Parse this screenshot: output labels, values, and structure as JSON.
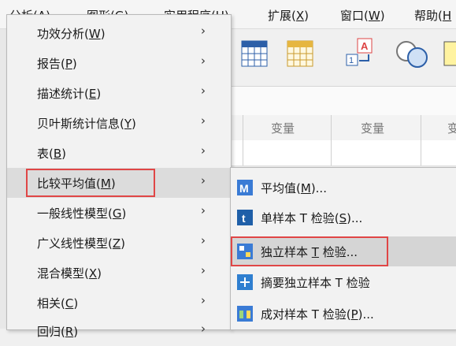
{
  "menubar": {
    "items": [
      {
        "label": "分析(",
        "key": "A",
        "tail": ")"
      },
      {
        "label": "图形(",
        "key": "G",
        "tail": ")"
      },
      {
        "label": "实用程序(",
        "key": "U",
        "tail": ")"
      },
      {
        "label": "扩展(",
        "key": "X",
        "tail": ")"
      },
      {
        "label": "窗口(",
        "key": "W",
        "tail": ")"
      },
      {
        "label": "帮助(",
        "key": "H",
        "tail": ""
      }
    ]
  },
  "grid": {
    "columns": [
      "变量",
      "变量",
      "变"
    ]
  },
  "analyze_menu": {
    "items": [
      {
        "label": "功效分析(",
        "key": "W",
        "tail": ")",
        "arrow": "›"
      },
      {
        "label": "报告(",
        "key": "P",
        "tail": ")",
        "arrow": "›"
      },
      {
        "label": "描述统计(",
        "key": "E",
        "tail": ")",
        "arrow": "›"
      },
      {
        "label": "贝叶斯统计信息(",
        "key": "Y",
        "tail": ")",
        "arrow": "›"
      },
      {
        "label": "表(",
        "key": "B",
        "tail": ")",
        "arrow": "›"
      },
      {
        "label": "比较平均值(",
        "key": "M",
        "tail": ")",
        "arrow": "›"
      },
      {
        "label": "一般线性模型(",
        "key": "G",
        "tail": ")",
        "arrow": "›"
      },
      {
        "label": "广义线性模型(",
        "key": "Z",
        "tail": ")",
        "arrow": "›"
      },
      {
        "label": "混合模型(",
        "key": "X",
        "tail": ")",
        "arrow": "›"
      },
      {
        "label": "相关(",
        "key": "C",
        "tail": ")",
        "arrow": "›"
      },
      {
        "label": "回归(",
        "key": "R",
        "tail": ")",
        "arrow": "›"
      }
    ]
  },
  "compare_means_submenu": {
    "items": [
      {
        "label": "平均值(",
        "key": "M",
        "tail": ")...",
        "icon": "means-icon",
        "color": "#3a7bd5"
      },
      {
        "label": "单样本 T 检验(",
        "key": "S",
        "tail": ")...",
        "icon": "one-sample-t-test-icon",
        "color": "#1f5fa8"
      },
      {
        "label": "独立样本 ",
        "key": "T",
        "tail": " 检验...",
        "icon": "independent-samples-t-test-icon",
        "color": "#3a7bd5"
      },
      {
        "label": "摘要独立样本 T 检验",
        "key": "",
        "tail": "",
        "icon": "summary-t-test-icon",
        "color": "#2f7fd0"
      },
      {
        "label": "成对样本 T 检验(",
        "key": "P",
        "tail": ")...",
        "icon": "paired-samples-t-test-icon",
        "color": "#3a7bd5"
      }
    ]
  },
  "colors": {
    "highlight_border": "#e04646",
    "menu_bg": "#f2f2f2",
    "selected_bg": "#d5d5d5"
  }
}
